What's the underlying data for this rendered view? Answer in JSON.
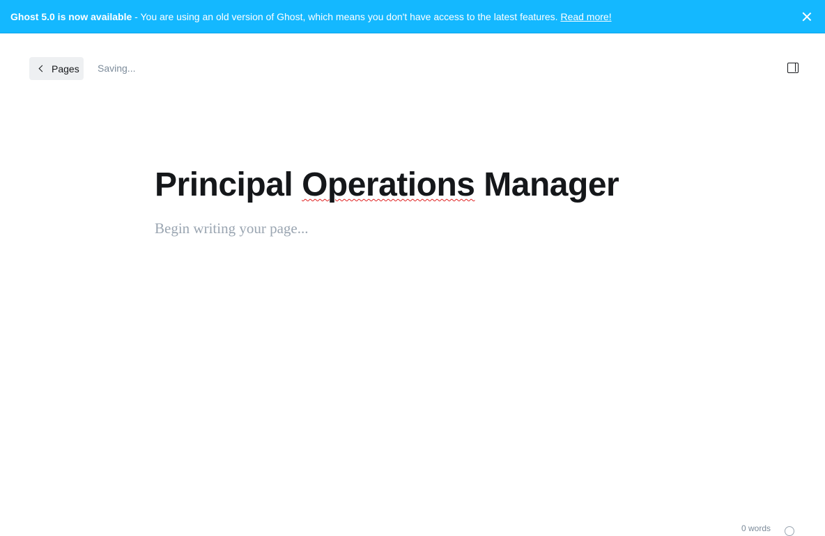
{
  "banner": {
    "strong_text": "Ghost 5.0 is now available",
    "message": " - You are using an old version of Ghost, which means you don't have access to the latest features. ",
    "link_label": "Read more!",
    "close_icon": "close-icon",
    "color": "#14b8ff"
  },
  "header": {
    "back_label": "Pages",
    "back_icon": "chevron-left-icon",
    "status": "Saving...",
    "settings_icon": "sidebar-toggle-icon"
  },
  "editor": {
    "title_part1": "Principal ",
    "title_misspelled": "Operations",
    "title_part2": " Manager",
    "placeholder": "Begin writing your page..."
  },
  "footer": {
    "word_count": "0 words",
    "help_icon": "help-icon"
  }
}
